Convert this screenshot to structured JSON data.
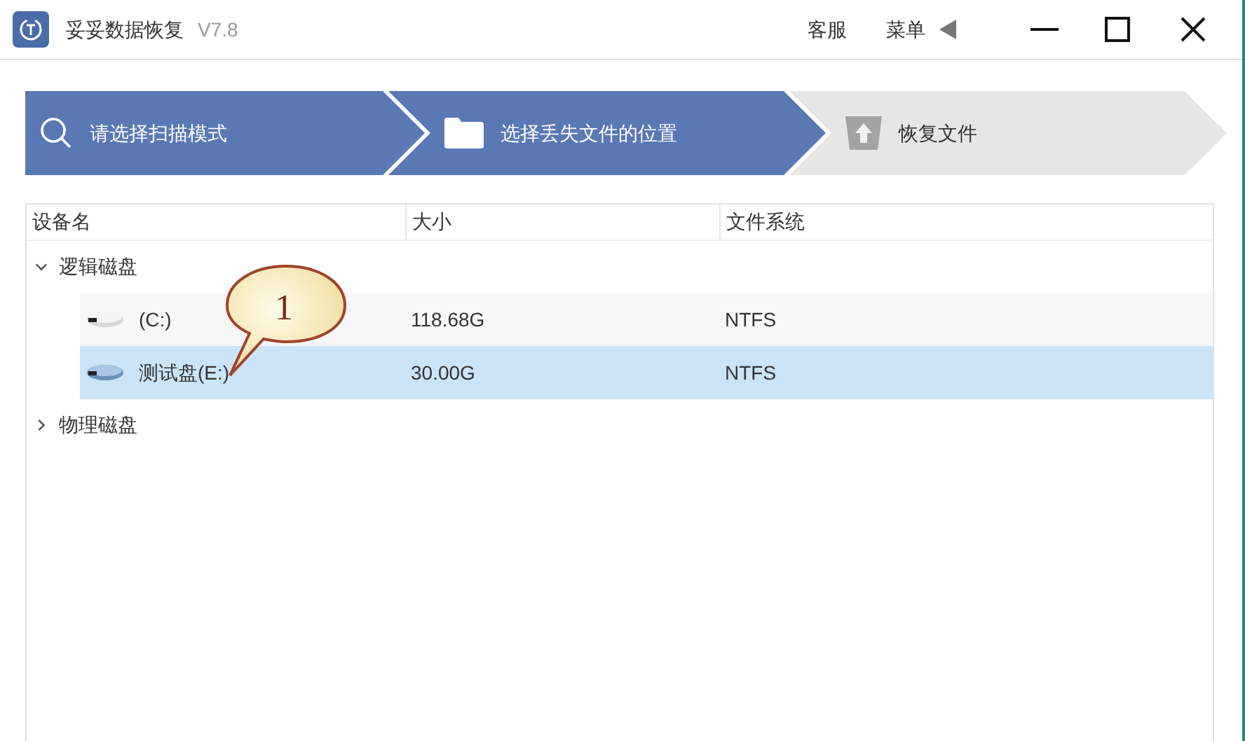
{
  "window": {
    "title": "妥妥数据恢复",
    "version": "V7.8",
    "menu": [
      "客服",
      "菜单"
    ]
  },
  "steps": [
    {
      "label": "请选择扫描模式",
      "kind": "search",
      "done": true
    },
    {
      "label": "选择丢失文件的位置",
      "kind": "folder",
      "done": true
    },
    {
      "label": "恢复文件",
      "kind": "upload",
      "done": false
    }
  ],
  "table": {
    "columns": [
      "设备名",
      "大小",
      "文件系统"
    ],
    "groups": [
      {
        "label": "逻辑磁盘",
        "expanded": true,
        "children": [
          {
            "name": "(C:)",
            "size": "118.68G",
            "fs": "NTFS",
            "selected": false
          },
          {
            "name": "测试盘(E:)",
            "size": "30.00G",
            "fs": "NTFS",
            "selected": true
          }
        ]
      },
      {
        "label": "物理磁盘",
        "expanded": false
      }
    ]
  },
  "callout": {
    "text": "1"
  }
}
